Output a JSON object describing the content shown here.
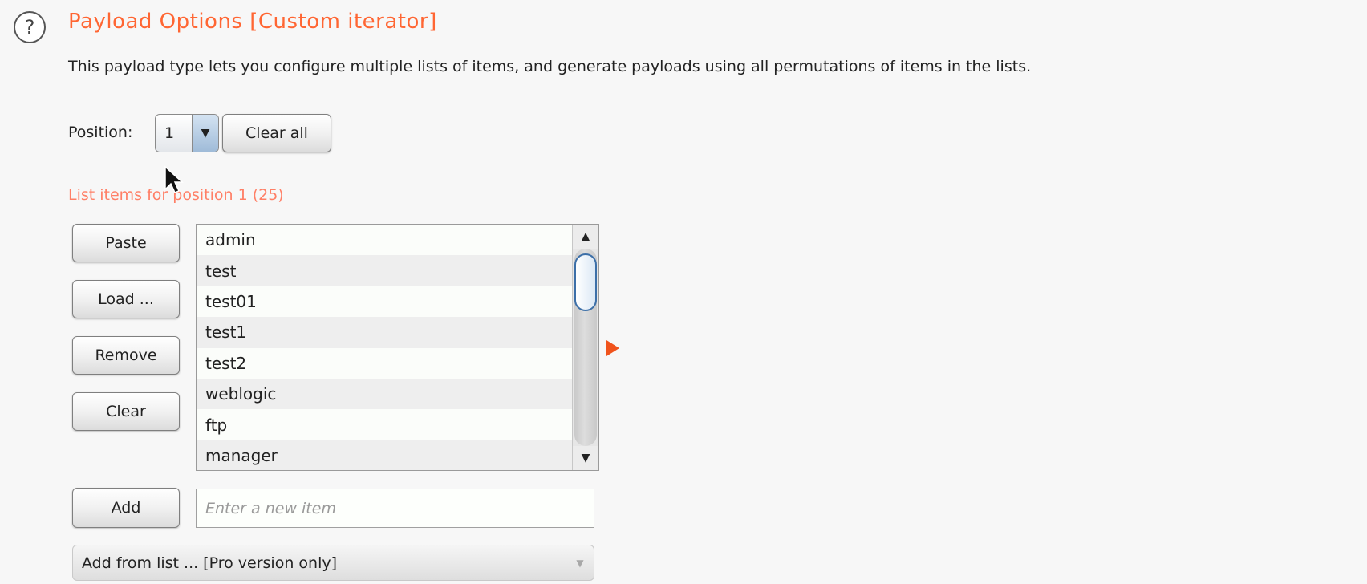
{
  "header": {
    "help_icon": "?",
    "title": "Payload Options [Custom iterator]"
  },
  "description": "This payload type lets you configure multiple lists of items, and generate payloads using all permutations of items in the lists.",
  "position": {
    "label": "Position:",
    "selected": "1",
    "dropdown_arrow": "▼",
    "clear_all_label": "Clear all"
  },
  "list": {
    "caption": "List items for position 1 (25)",
    "items": [
      "admin",
      "test",
      "test01",
      "test1",
      "test2",
      "weblogic",
      "ftp",
      "manager"
    ],
    "scroll_up": "▲",
    "scroll_down": "▼"
  },
  "buttons": {
    "paste": "Paste",
    "load": "Load ...",
    "remove": "Remove",
    "clear": "Clear",
    "add": "Add"
  },
  "new_item": {
    "placeholder": "Enter a new item",
    "value": ""
  },
  "add_from_list": {
    "label": "Add from list ... [Pro version only]",
    "arrow": "▼"
  },
  "colors": {
    "title": "#ff6633",
    "caption": "#ff7f66",
    "expand_arrow": "#f0531c",
    "scroll_thumb_border": "#3c6fa8"
  }
}
